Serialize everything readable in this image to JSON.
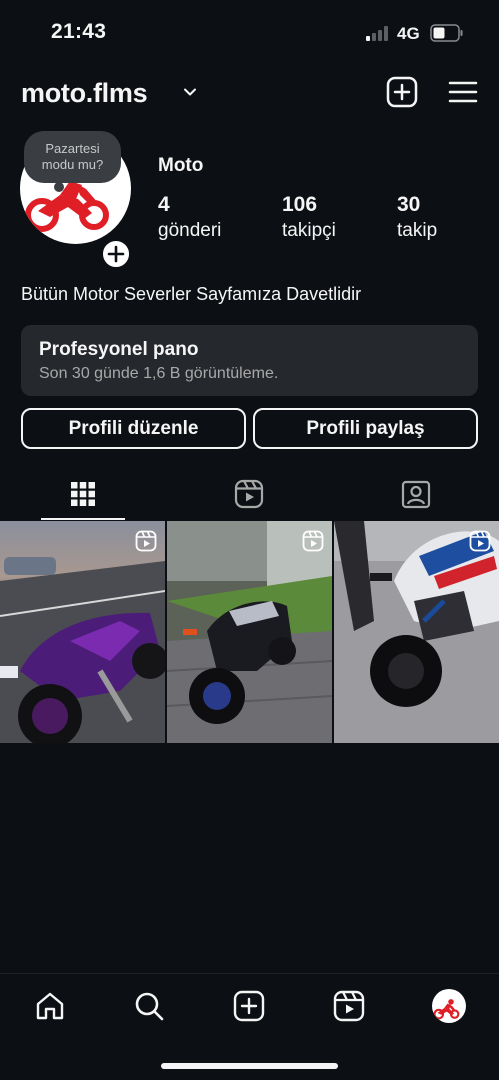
{
  "status_bar": {
    "time": "21:43",
    "network": "4G"
  },
  "header": {
    "username": "moto.flms",
    "icons": [
      "chevron-down-icon",
      "create-plus-icon",
      "hamburger-menu-icon"
    ]
  },
  "profile": {
    "note": "Pazartesi modu mu?",
    "name": "Moto",
    "stats": [
      {
        "value": "4",
        "label": "gönderi"
      },
      {
        "value": "106",
        "label": "takipçi"
      },
      {
        "value": "30",
        "label": "takip"
      }
    ],
    "bio": "Bütün Motor Severler Sayfamıza Davetlidir"
  },
  "pro_dashboard": {
    "title": "Profesyonel pano",
    "subtitle": "Son 30 günde 1,6 B görüntüleme."
  },
  "actions": {
    "edit_profile": "Profili düzenle",
    "share_profile": "Profili paylaş"
  },
  "tabs": [
    "grid-icon",
    "reels-icon",
    "tagged-icon"
  ],
  "posts": [
    {
      "type": "reel",
      "subject": "purple motorcycle"
    },
    {
      "type": "reel",
      "subject": "black motorcycle"
    },
    {
      "type": "reel",
      "subject": "white bmw motorcycle"
    }
  ],
  "bottom_nav": [
    "home-icon",
    "search-icon",
    "create-icon",
    "reels-icon",
    "profile-avatar"
  ],
  "colors": {
    "background": "#0c1014",
    "panel": "#25292e",
    "text": "#f5f5f5",
    "muted": "#a8a8a8",
    "logo_red": "#e01e26"
  }
}
